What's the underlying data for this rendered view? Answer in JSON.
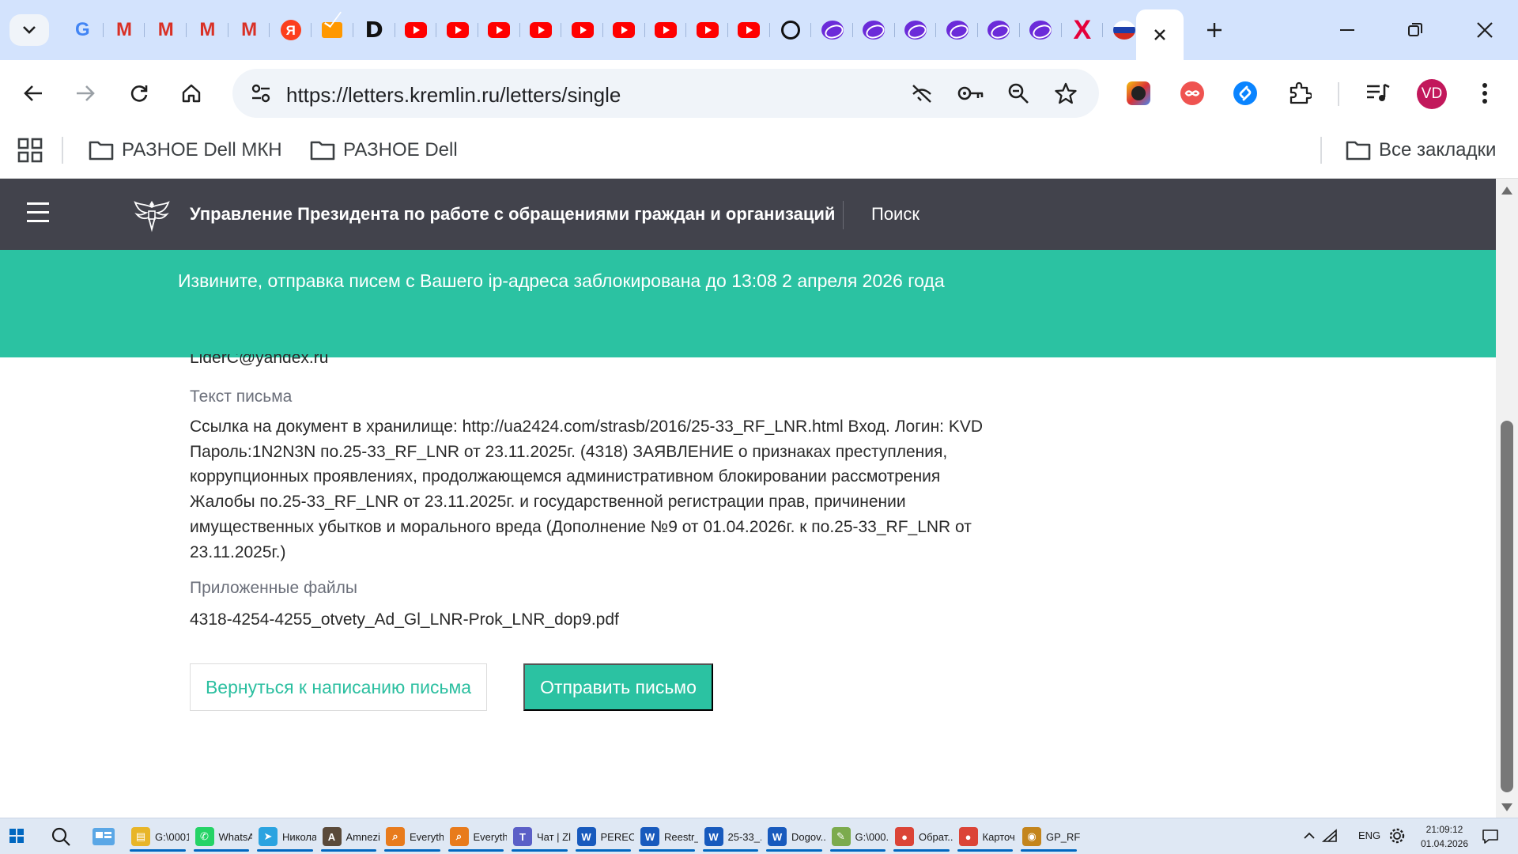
{
  "browser": {
    "tabs": [
      {
        "icon": "google-icon",
        "glyph": "G"
      },
      {
        "icon": "gmail-icon",
        "glyph": "M"
      },
      {
        "icon": "gmail-icon",
        "glyph": "M"
      },
      {
        "icon": "gmail-icon",
        "glyph": "M"
      },
      {
        "icon": "gmail-icon",
        "glyph": "M"
      },
      {
        "icon": "yandex-icon",
        "glyph": "Я"
      },
      {
        "icon": "mail-icon",
        "glyph": ""
      },
      {
        "icon": "d-icon",
        "glyph": "D"
      },
      {
        "icon": "youtube-icon",
        "glyph": ""
      },
      {
        "icon": "youtube-icon",
        "glyph": ""
      },
      {
        "icon": "youtube-icon",
        "glyph": ""
      },
      {
        "icon": "youtube-icon",
        "glyph": ""
      },
      {
        "icon": "youtube-icon",
        "glyph": ""
      },
      {
        "icon": "youtube-icon",
        "glyph": ""
      },
      {
        "icon": "youtube-icon",
        "glyph": ""
      },
      {
        "icon": "youtube-icon",
        "glyph": ""
      },
      {
        "icon": "youtube-icon",
        "glyph": ""
      },
      {
        "icon": "chatgpt-icon",
        "glyph": ""
      },
      {
        "icon": "ring-icon",
        "glyph": ""
      },
      {
        "icon": "ring-icon",
        "glyph": ""
      },
      {
        "icon": "ring-icon",
        "glyph": ""
      },
      {
        "icon": "ring-icon",
        "glyph": ""
      },
      {
        "icon": "ring-icon",
        "glyph": ""
      },
      {
        "icon": "ring-icon",
        "glyph": ""
      },
      {
        "icon": "x-icon",
        "glyph": "X"
      },
      {
        "icon": "russia-flag-icon",
        "glyph": ""
      }
    ],
    "url": "https://letters.kremlin.ru/letters/single",
    "profile_initials": "VD",
    "bookmarks": [
      {
        "label": "РАЗНОЕ Dell МКН"
      },
      {
        "label": "РАЗНОЕ Dell"
      }
    ],
    "all_bookmarks_label": "Все закладки"
  },
  "page": {
    "site_title": "Управление Президента по работе с обращениями граждан и организаций",
    "search_label": "Поиск",
    "notice": "Извините, отправка писем с Вашего ip-адреса заблокирована до 13:08 2 апреля 2026 года",
    "email": "LiderC@yandex.ru",
    "letter_text_label": "Текст письма",
    "letter_text": "Ссылка на документ в хранилище: http://ua2424.com/strasb/2016/25-33_RF_LNR.html Вход. Логин: KVD Пароль:1N2N3N по.25-33_RF_LNR от 23.11.2025г. (4318) ЗАЯВЛЕНИЕ о признаках преступления, коррупционных проявлениях, продолжающемся административном блокировании рассмотрения Жалобы по.25-33_RF_LNR от 23.11.2025г. и государственной регистрации прав, причинении имущественных убытков и морального вреда (Дополнение №9 от 01.04.2026г. к по.25-33_RF_LNR от 23.11.2025г.)",
    "attached_files_label": "Приложенные файлы",
    "attached_file": "4318-4254-4255_otvety_Ad_Gl_LNR-Prok_LNR_dop9.pdf",
    "back_button": "Вернуться к написанию письма",
    "send_button": "Отправить письмо"
  },
  "taskbar": {
    "items": [
      {
        "label": "G:\\0001...",
        "icon": "explorer-icon",
        "color": "#e8b528"
      },
      {
        "label": "WhatsA...",
        "icon": "whatsapp-icon",
        "color": "#25d366"
      },
      {
        "label": "Никола...",
        "icon": "telegram-icon",
        "color": "#2aa3e0"
      },
      {
        "label": "Amnezi...",
        "icon": "amnezia-icon",
        "color": "#5a4a3a"
      },
      {
        "label": "Everythi...",
        "icon": "everything-icon",
        "color": "#e87b1c"
      },
      {
        "label": "Everyth...",
        "icon": "everything-icon",
        "color": "#e87b1c"
      },
      {
        "label": "Чат | Zl...",
        "icon": "teams-icon",
        "color": "#5b5fc7"
      },
      {
        "label": "PEREC...",
        "icon": "word-icon",
        "color": "#185abd"
      },
      {
        "label": "Reestr_i...",
        "icon": "word-icon",
        "color": "#185abd"
      },
      {
        "label": "25-33_...",
        "icon": "word-icon",
        "color": "#185abd"
      },
      {
        "label": "Dogov...",
        "icon": "word-icon",
        "color": "#185abd"
      },
      {
        "label": "G:\\000...",
        "icon": "notepad-icon",
        "color": "#7cab4d"
      },
      {
        "label": "Обрат...",
        "icon": "chrome-icon",
        "color": "#db4437"
      },
      {
        "label": "Карточ...",
        "icon": "chrome-icon",
        "color": "#db4437"
      },
      {
        "label": "GP_RF_...",
        "icon": "viewer-icon",
        "color": "#c4851c"
      }
    ],
    "lang": "ENG",
    "time": "21:09:12",
    "date": "01.04.2026"
  }
}
